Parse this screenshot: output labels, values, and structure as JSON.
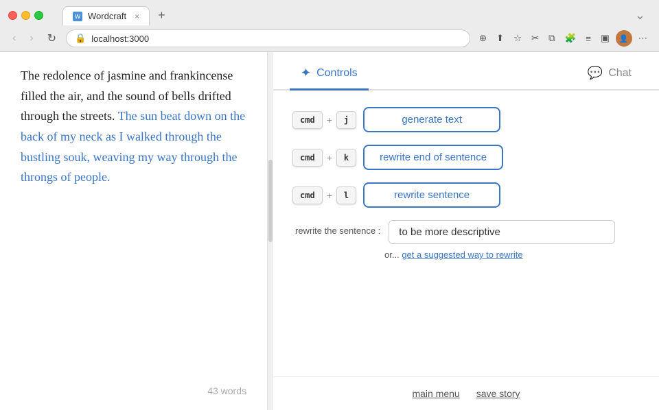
{
  "browser": {
    "tab_title": "Wordcraft",
    "url": "localhost:3000",
    "new_tab_label": "+",
    "tab_close": "×"
  },
  "nav": {
    "back": "‹",
    "forward": "›",
    "refresh": "↻",
    "url_label": "localhost:3000"
  },
  "editor": {
    "text_before": "The redolence of jasmine and frankincense filled the air, and the sound of bells drifted through the streets.",
    "text_highlighted": "The sun beat down on the back of my neck as I walked through the bustling souk, weaving my way through the throngs of people.",
    "word_count": "43 words"
  },
  "pane_tabs": [
    {
      "label": "Controls",
      "icon": "✦",
      "active": true
    },
    {
      "label": "Chat",
      "icon": "💬",
      "active": false
    }
  ],
  "controls": {
    "rows": [
      {
        "mod": "cmd",
        "plus": "+",
        "key": "j",
        "button_label": "generate text"
      },
      {
        "mod": "cmd",
        "plus": "+",
        "key": "k",
        "button_label": "rewrite end of sentence"
      },
      {
        "mod": "cmd",
        "plus": "+",
        "key": "l",
        "button_label": "rewrite sentence"
      }
    ],
    "rewrite_label": "rewrite the sentence :",
    "rewrite_placeholder": "to be more descriptive",
    "rewrite_value": "to be more descriptive",
    "suggested_prefix": "or...",
    "suggested_link": "get a suggested way to rewrite"
  },
  "footer": {
    "main_menu": "main menu",
    "save_story": "save story"
  }
}
